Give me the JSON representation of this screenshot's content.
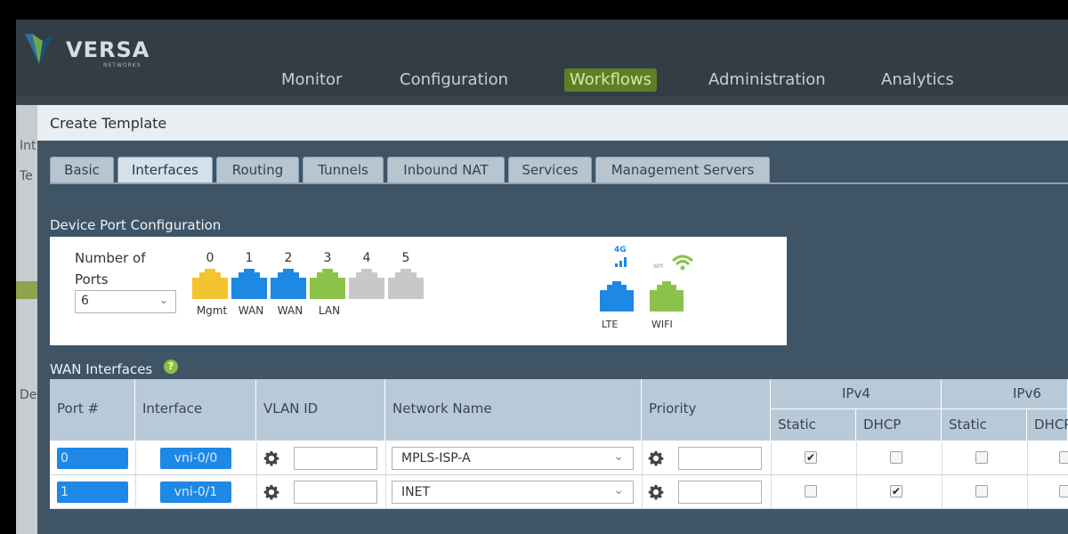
{
  "brand": {
    "name": "VERSA",
    "sub": "NETWORKS"
  },
  "nav": [
    "Monitor",
    "Configuration",
    "Workflows",
    "Administration",
    "Analytics"
  ],
  "nav_active": "Workflows",
  "left_peek": [
    "Int",
    "Te",
    "De"
  ],
  "dialog": {
    "title": "Create Template"
  },
  "tabs": [
    "Basic",
    "Interfaces",
    "Routing",
    "Tunnels",
    "Inbound NAT",
    "Services",
    "Management Servers"
  ],
  "active_tab": "Interfaces",
  "device_port": {
    "title": "Device Port Configuration",
    "number_of_ports_label": "Number of Ports",
    "number_of_ports_value": "6",
    "ports": [
      {
        "num": "0",
        "label": "Mgmt",
        "color": "#f4c430"
      },
      {
        "num": "1",
        "label": "WAN",
        "color": "#1e88e5"
      },
      {
        "num": "2",
        "label": "WAN",
        "color": "#1e88e5"
      },
      {
        "num": "3",
        "label": "LAN",
        "color": "#8bc34a"
      },
      {
        "num": "4",
        "label": "",
        "color": "#c8c8c8"
      },
      {
        "num": "5",
        "label": "",
        "color": "#c8c8c8"
      }
    ],
    "lte": {
      "label": "LTE",
      "badge": "4G",
      "color": "#1e88e5"
    },
    "wifi": {
      "label": "WIFI",
      "badge": "Wifi",
      "color": "#8bc34a"
    }
  },
  "wan": {
    "title": "WAN Interfaces",
    "help_icon": "question-icon",
    "headers": {
      "port": "Port #",
      "interface": "Interface",
      "vlan": "VLAN ID",
      "network": "Network Name",
      "priority": "Priority",
      "ipv4": "IPv4",
      "ipv6": "IPv6",
      "static": "Static",
      "dhcp": "DHCP"
    },
    "rows": [
      {
        "port": "0",
        "interface": "vni-0/0",
        "network": "MPLS-ISP-A",
        "ipv4_static": true,
        "ipv4_dhcp": false,
        "ipv6_static": false,
        "ipv6_dhcp": false
      },
      {
        "port": "1",
        "interface": "vni-0/1",
        "network": "INET",
        "ipv4_static": false,
        "ipv4_dhcp": true,
        "ipv6_static": false,
        "ipv6_dhcp": false
      }
    ]
  }
}
